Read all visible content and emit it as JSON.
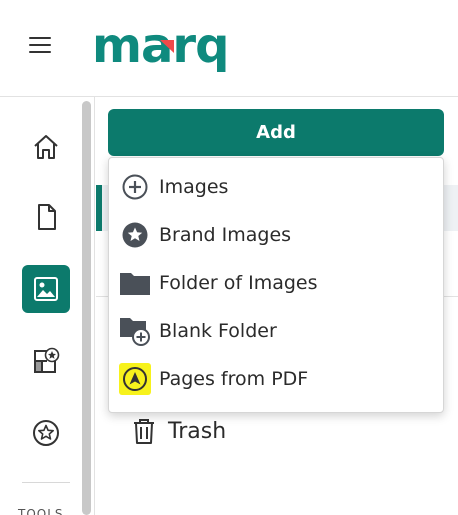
{
  "header": {
    "logo_text": "marq",
    "brand_color": "#0f8a7e",
    "logo_accent_color": "#ef4a4a"
  },
  "rail": {
    "items": [
      {
        "name": "home",
        "icon": "home-icon"
      },
      {
        "name": "documents",
        "icon": "document-icon"
      },
      {
        "name": "images",
        "icon": "image-icon",
        "active": true
      },
      {
        "name": "brand-templates",
        "icon": "brand-template-icon"
      },
      {
        "name": "favorites",
        "icon": "star-icon"
      }
    ],
    "tools_label": "TOOLS"
  },
  "main": {
    "add_label": "Add",
    "accent_color": "#0c7a6c",
    "trash_label": "Trash"
  },
  "dropdown": {
    "items": [
      {
        "label": "Images",
        "icon": "plus-circle-icon"
      },
      {
        "label": "Brand Images",
        "icon": "star-circle-icon"
      },
      {
        "label": "Folder of Images",
        "icon": "folder-icon"
      },
      {
        "label": "Blank Folder",
        "icon": "folder-plus-icon"
      },
      {
        "label": "Pages from PDF",
        "icon": "pdf-icon",
        "highlight_color": "#f7f21c"
      }
    ]
  }
}
